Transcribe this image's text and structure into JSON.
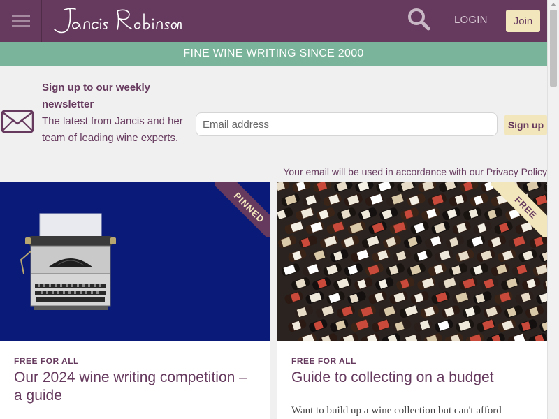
{
  "header": {
    "logo_text": "Jancis Robinson",
    "login_label": "LOGIN",
    "join_label": "Join",
    "menu_icon": "hamburger-icon",
    "search_icon": "search-icon"
  },
  "banner": {
    "text": "FINE WINE WRITING SINCE 2000"
  },
  "newsletter": {
    "title": "Sign up to our weekly newsletter",
    "description": "The latest from Jancis and her team of leading wine experts.",
    "email_placeholder": "Email address",
    "signup_label": "Sign up",
    "privacy_lead": "Your email will be used in accordance with our ",
    "privacy_link": "Privacy Policy",
    "icon": "envelope-icon"
  },
  "cards": [
    {
      "ribbon": "PINNED",
      "label": "FREE FOR ALL",
      "title": "Our 2024 wine writing competition – a guide",
      "image": "typewriter-image"
    },
    {
      "ribbon": "FREE",
      "label": "FREE FOR ALL",
      "title": "Guide to collecting on a budget",
      "excerpt": "Want to build up a wine collection but can't afford",
      "image": "wine-rack-image"
    }
  ],
  "colors": {
    "brand_purple": "#663a5e",
    "banner_green": "#7ab59b",
    "accent_cream": "#f2e6bd",
    "page_background": "#f0f0f0",
    "card1_background": "#0a1a78"
  }
}
